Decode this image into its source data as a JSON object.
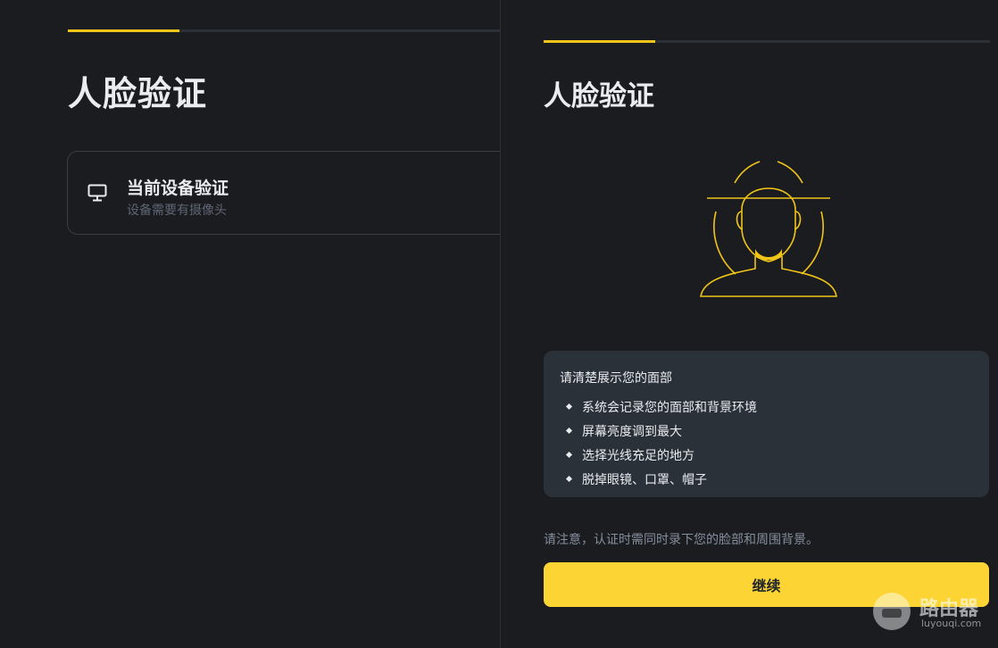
{
  "left": {
    "progress_fraction": 0.25,
    "title": "人脸验证",
    "option": {
      "title": "当前设备验证",
      "subtitle": "设备需要有摄像头",
      "icon": "monitor-icon"
    }
  },
  "right": {
    "progress_fraction": 0.25,
    "title": "人脸验证",
    "illustration": "face-scan-illustration",
    "tips": {
      "heading": "请清楚展示您的面部",
      "items": [
        "系统会记录您的面部和背景环境",
        "屏幕亮度调到最大",
        "选择光线充足的地方",
        "脱掉眼镜、口罩、帽子"
      ]
    },
    "notice": "请注意，认证时需同时录下您的脸部和周围背景。",
    "continue_label": "继续"
  },
  "watermark": {
    "text": "路由器",
    "sub": "luyouqi.com"
  },
  "colors": {
    "accent": "#fcd535",
    "background": "#1b1c20",
    "card": "#2b3139",
    "text": "#eaecef",
    "muted": "#848e9c"
  }
}
